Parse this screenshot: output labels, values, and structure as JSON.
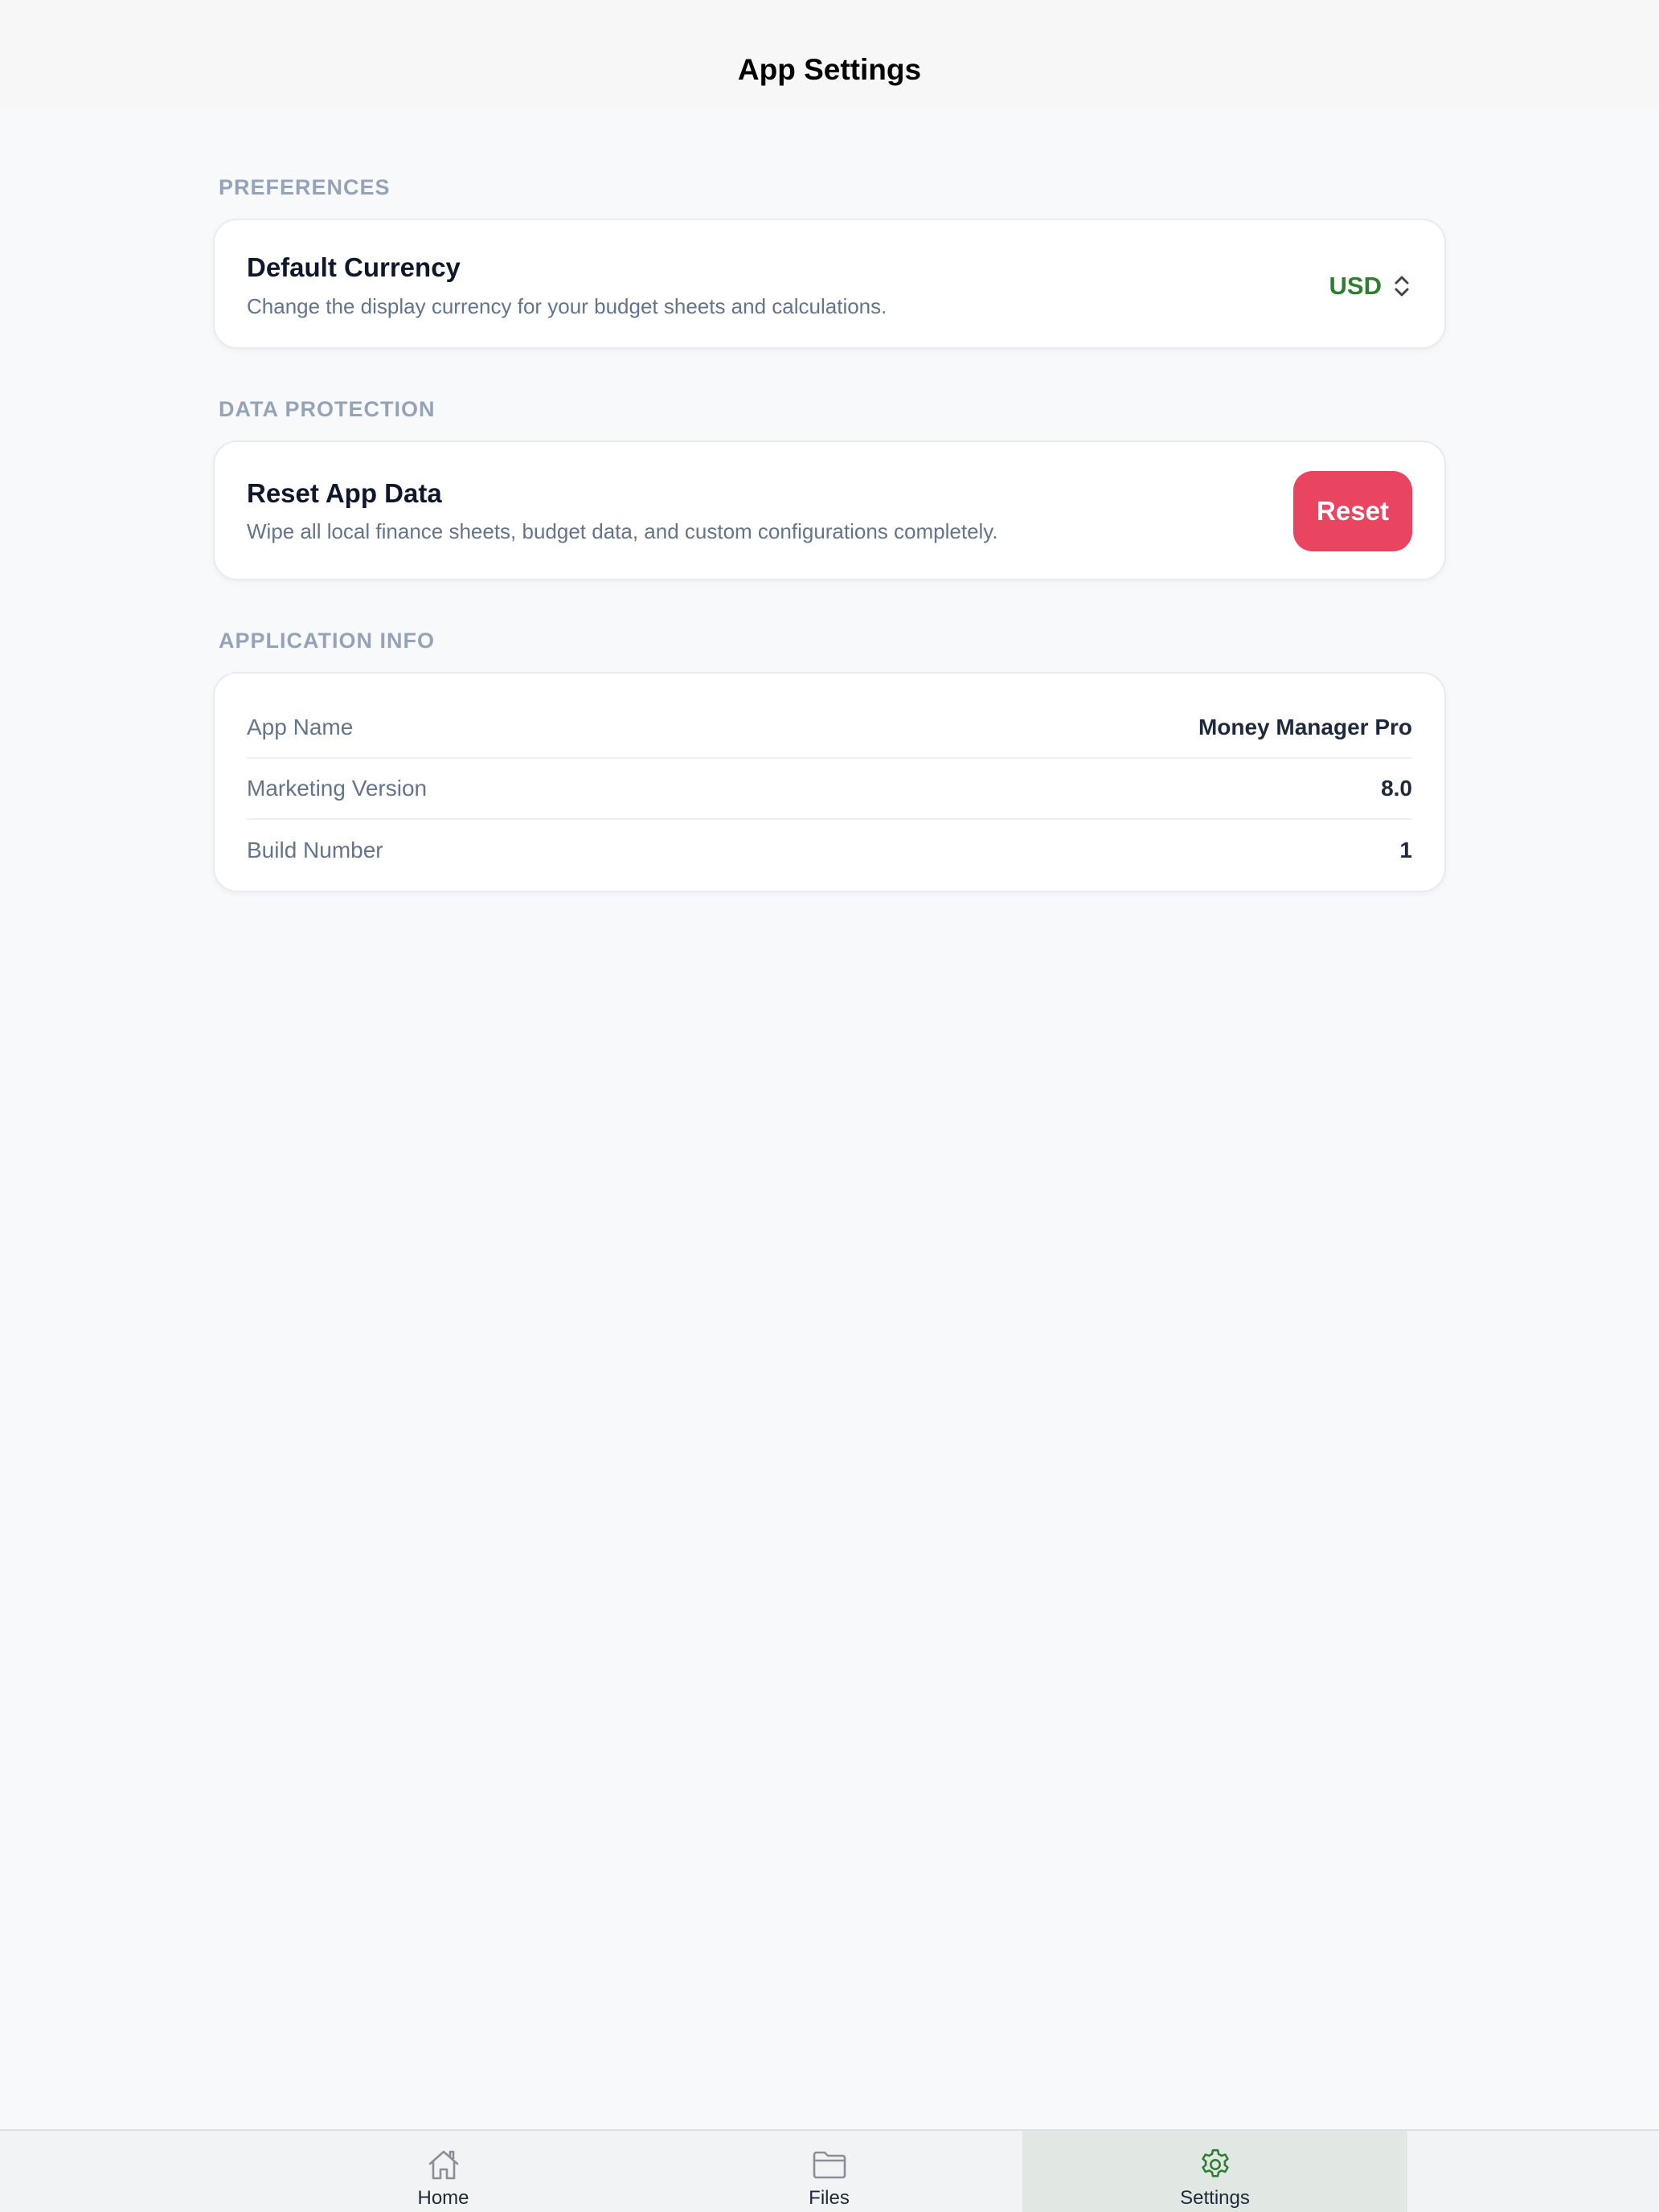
{
  "navbar": {
    "title": "App Settings"
  },
  "preferences": {
    "header": "PREFERENCES",
    "currency": {
      "title": "Default Currency",
      "description": "Change the display currency for your budget sheets and calculations.",
      "value": "USD",
      "icon": "chevron-updown-icon"
    }
  },
  "data_protection": {
    "header": "DATA PROTECTION",
    "reset": {
      "title": "Reset App Data",
      "description": "Wipe all local finance sheets, budget data, and custom configurations completely.",
      "button_label": "Reset"
    }
  },
  "app_info": {
    "header": "APPLICATION INFO",
    "rows": [
      {
        "label": "App Name",
        "value": "Money Manager Pro"
      },
      {
        "label": "Marketing Version",
        "value": "8.0"
      },
      {
        "label": "Build Number",
        "value": "1"
      }
    ]
  },
  "tabbar": {
    "tabs": [
      {
        "label": "Home",
        "icon": "home-icon",
        "active": false
      },
      {
        "label": "Files",
        "icon": "folder-icon",
        "active": false
      },
      {
        "label": "Settings",
        "icon": "gear-icon",
        "active": true
      }
    ]
  },
  "colors": {
    "accent_green": "#2e7d32",
    "destructive": "#e94560",
    "section_header": "#94a3b8",
    "active_tab_bg": "#e1e8e3"
  }
}
